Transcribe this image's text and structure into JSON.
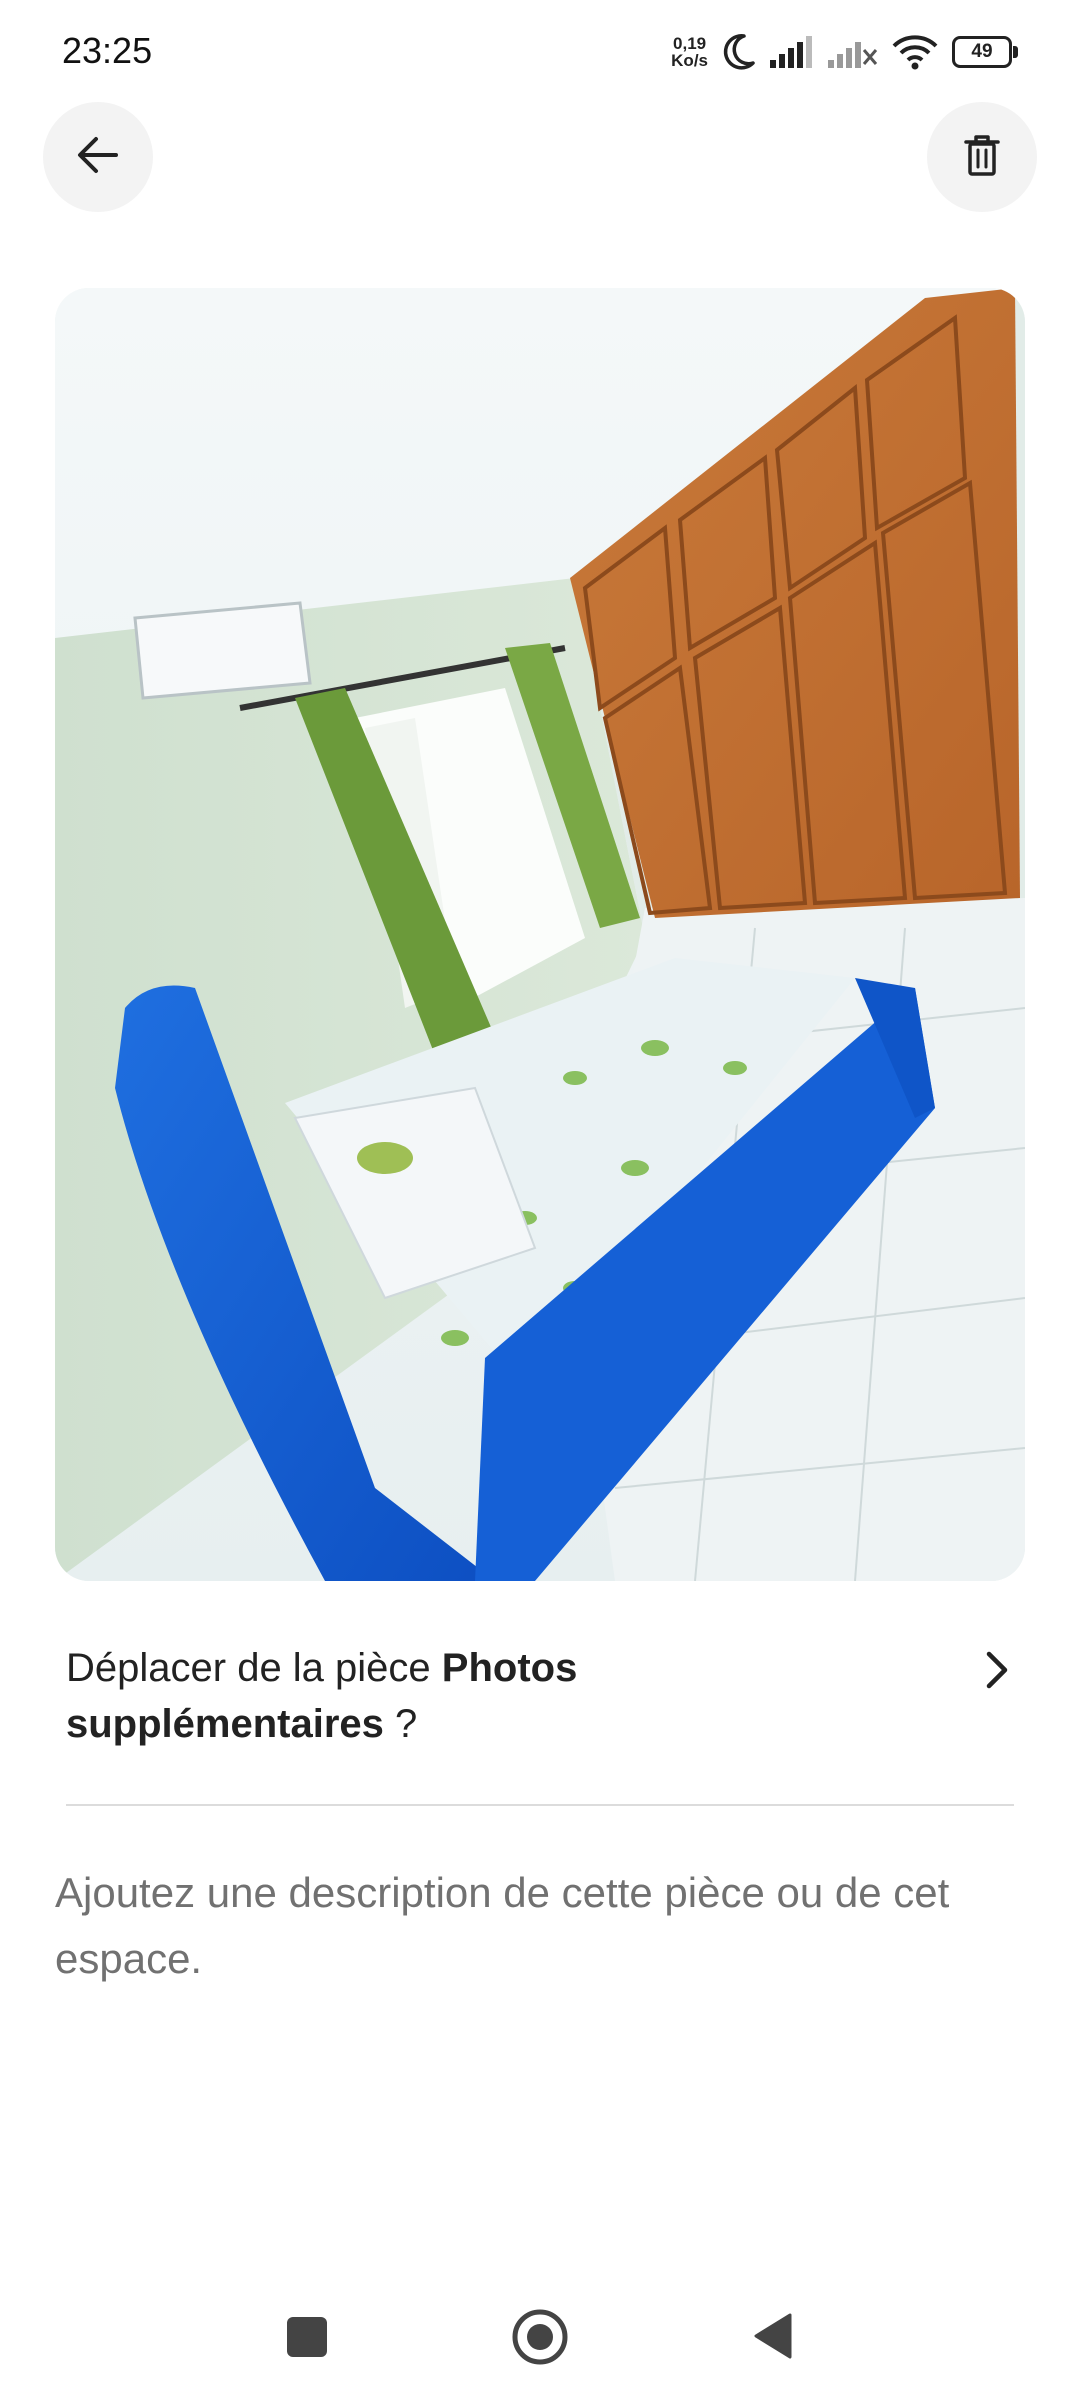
{
  "status_bar": {
    "time": "23:25",
    "net_speed_value": "0,19",
    "net_speed_unit": "Ko/s",
    "battery_level": "49",
    "icons": [
      "moon-icon",
      "signal-icon",
      "signal-no-service-icon",
      "wifi-icon",
      "battery-icon"
    ]
  },
  "header": {
    "back_icon": "arrow-left-icon",
    "delete_icon": "trash-icon"
  },
  "photo": {
    "subject": "bedroom-photo"
  },
  "move_row": {
    "prefix": "Déplacer de la pièce",
    "room_name": "Photos supplémentaires",
    "suffix": " ?",
    "icon": "chevron-right-icon"
  },
  "description": {
    "placeholder": "Ajoutez une description de cette pièce ou de cet espace."
  },
  "nav_bar": {
    "icons": [
      "recent-apps-icon",
      "home-icon",
      "back-triangle-icon"
    ]
  }
}
